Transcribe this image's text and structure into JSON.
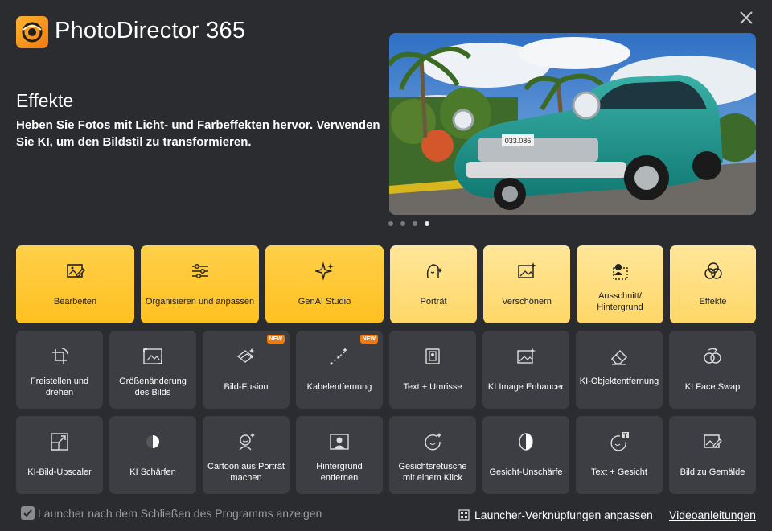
{
  "app": {
    "title": "PhotoDirector 365",
    "accent": "#f7b52a"
  },
  "feature": {
    "title": "Effekte",
    "description": "Heben Sie Fotos mit Licht- und Farbeffekten hervor. Verwenden Sie KI, um den Bildstil zu transformieren.",
    "carousel_pages": 4,
    "carousel_active": 4,
    "license_plate": "033.086"
  },
  "tiles_row1": [
    {
      "label": "Bearbeiten",
      "icon": "edit-photo-icon",
      "style": "orange"
    },
    {
      "label": "Organisieren und anpassen",
      "icon": "sliders-icon",
      "style": "orange"
    },
    {
      "label": "GenAI Studio",
      "icon": "sparkles-icon",
      "style": "orange"
    },
    {
      "label": "Porträt",
      "icon": "portrait-icon",
      "style": "light"
    },
    {
      "label": "Verschönern",
      "icon": "enhance-photo-icon",
      "style": "light"
    },
    {
      "label": "Ausschnitt/ Hintergrund",
      "icon": "cutout-icon",
      "style": "light"
    },
    {
      "label": "Effekte",
      "icon": "effects-circles-icon",
      "style": "light"
    }
  ],
  "tiles_row2": [
    {
      "label": "Freistellen und drehen",
      "icon": "crop-rotate-icon",
      "badge": ""
    },
    {
      "label": "Größenänderung des Bilds",
      "icon": "resize-image-icon",
      "badge": ""
    },
    {
      "label": "Bild-Fusion",
      "icon": "image-fusion-icon",
      "badge": "NEW"
    },
    {
      "label": "Kabelentfernung",
      "icon": "wire-removal-icon",
      "badge": "NEW"
    },
    {
      "label": "Text + Umrisse",
      "icon": "text-outline-icon",
      "badge": ""
    },
    {
      "label": "KI Image Enhancer",
      "icon": "ai-enhancer-icon",
      "badge": ""
    },
    {
      "label": "KI-Objektentfernung",
      "icon": "eraser-icon",
      "badge": ""
    },
    {
      "label": "KI Face Swap",
      "icon": "face-swap-icon",
      "badge": ""
    }
  ],
  "tiles_row3": [
    {
      "label": "KI-Bild-Upscaler",
      "icon": "upscale-icon"
    },
    {
      "label": "KI Schärfen",
      "icon": "sharpen-icon"
    },
    {
      "label": "Cartoon aus Porträt machen",
      "icon": "cartoon-portrait-icon"
    },
    {
      "label": "Hintergrund entfernen",
      "icon": "remove-background-icon"
    },
    {
      "label": "Gesichtsretusche mit einem Klick",
      "icon": "face-retouch-icon"
    },
    {
      "label": "Gesicht-Unschärfe",
      "icon": "face-blur-icon"
    },
    {
      "label": "Text + Gesicht",
      "icon": "text-face-icon"
    },
    {
      "label": "Bild zu Gemälde",
      "icon": "photo-to-painting-icon"
    }
  ],
  "footer": {
    "show_launcher_label": "Launcher nach dem Schließen des Programms anzeigen",
    "show_launcher_checked": true,
    "customize_shortcuts_label": "Launcher-Verknüpfungen anpassen",
    "video_tutorials_label": "Videoanleitungen"
  }
}
